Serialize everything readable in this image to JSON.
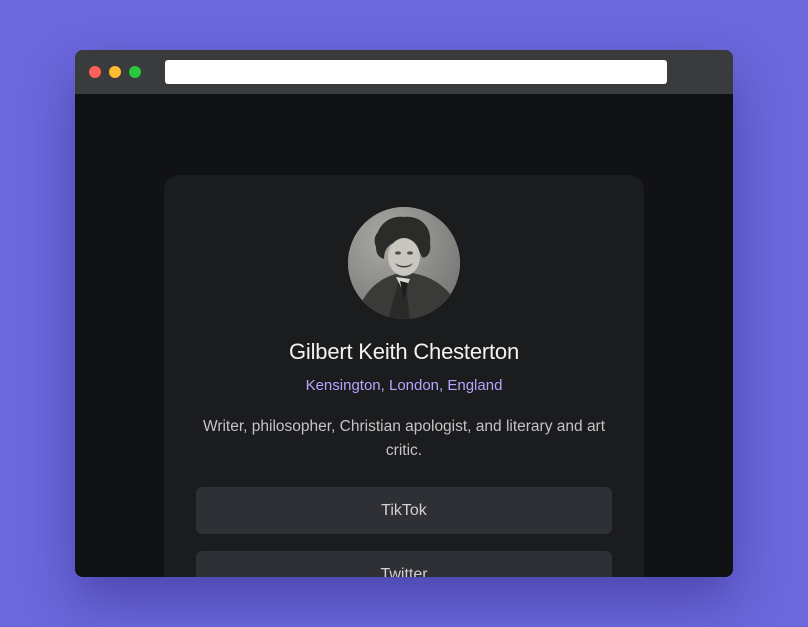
{
  "browser": {
    "controls": [
      "close",
      "minimize",
      "maximize"
    ],
    "url": ""
  },
  "profile": {
    "avatar_alt": "portrait photo",
    "name": "Gilbert Keith Chesterton",
    "location": "Kensington, London, England",
    "bio": "Writer, philosopher, Christian apologist, and literary and art critic."
  },
  "links": [
    {
      "label": "TikTok"
    },
    {
      "label": "Twitter"
    }
  ],
  "colors": {
    "page_background": "#6b68dc",
    "window_background": "#111213",
    "card_background": "#1b1c1e",
    "button_background": "#2e3035",
    "accent": "#b4a6ff"
  }
}
